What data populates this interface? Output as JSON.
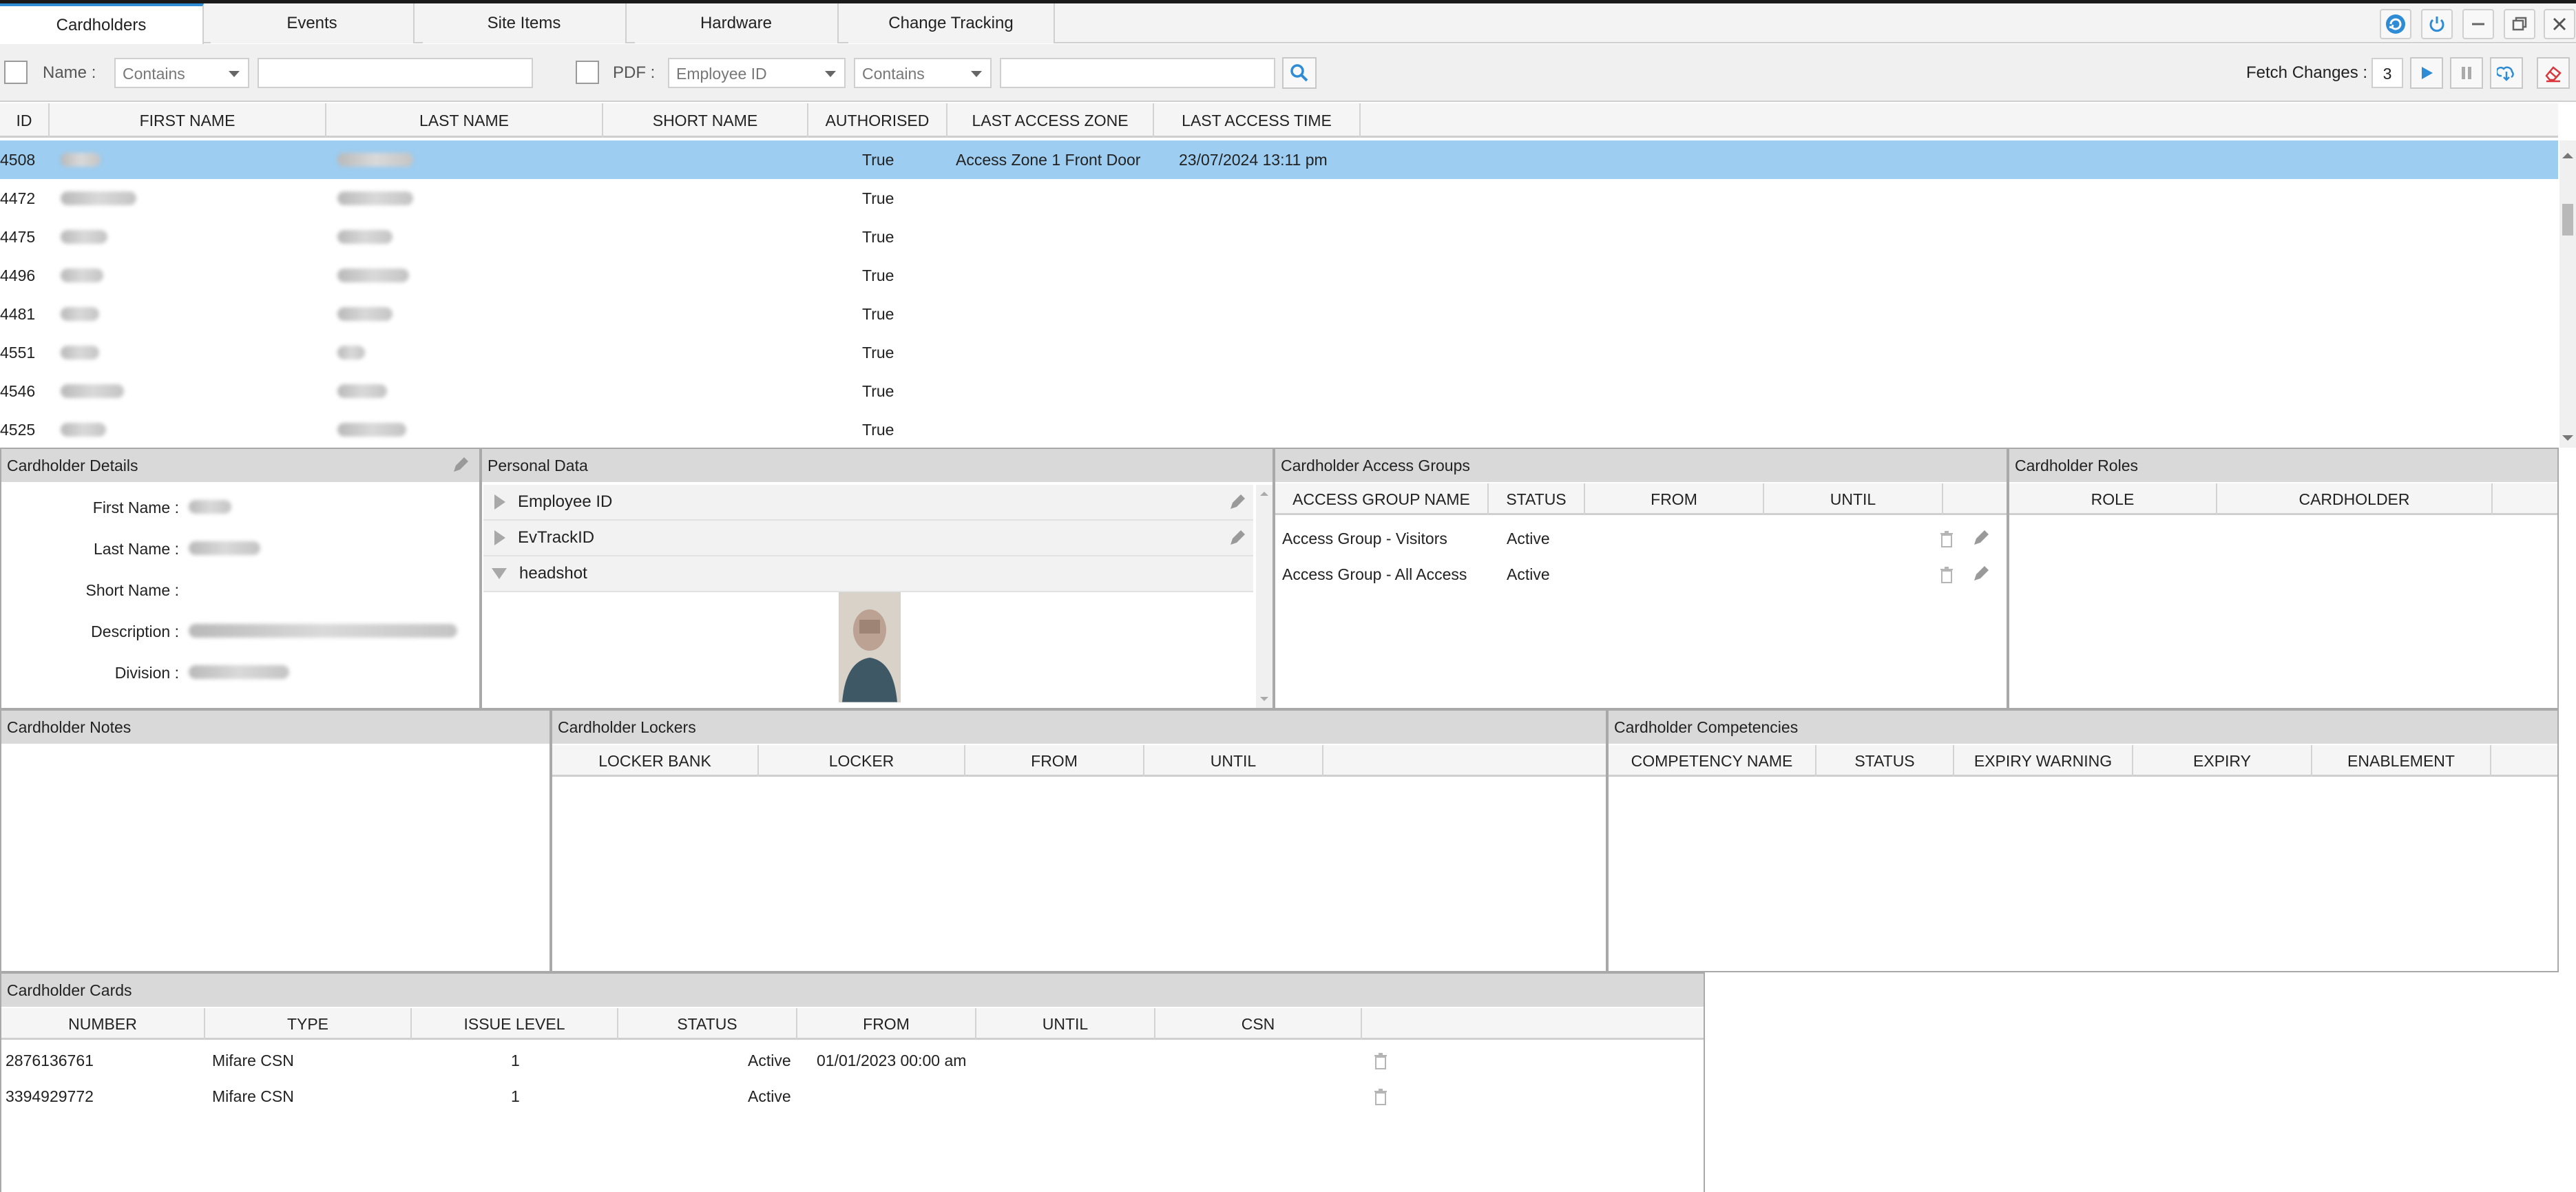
{
  "tabs": [
    "Cardholders",
    "Events",
    "Site Items",
    "Hardware",
    "Change Tracking"
  ],
  "filter": {
    "name_label": "Name :",
    "name_mode": "Contains",
    "name_value": "",
    "pdf_label": "PDF :",
    "pdf_field": "Employee ID",
    "pdf_mode": "Contains",
    "pdf_value": "",
    "fetch_label": "Fetch Changes :",
    "fetch_value": "3"
  },
  "grid": {
    "columns": [
      "ID",
      "FIRST NAME",
      "LAST NAME",
      "SHORT NAME",
      "AUTHORISED",
      "LAST ACCESS ZONE",
      "LAST ACCESS TIME"
    ],
    "rows": [
      {
        "id": "4508",
        "authorised": "True",
        "zone": "Access Zone 1 Front Door",
        "time": "23/07/2024 13:11 pm"
      },
      {
        "id": "4472",
        "authorised": "True",
        "zone": "",
        "time": ""
      },
      {
        "id": "4475",
        "authorised": "True",
        "zone": "",
        "time": ""
      },
      {
        "id": "4496",
        "authorised": "True",
        "zone": "",
        "time": ""
      },
      {
        "id": "4481",
        "authorised": "True",
        "zone": "",
        "time": ""
      },
      {
        "id": "4551",
        "authorised": "True",
        "zone": "",
        "time": ""
      },
      {
        "id": "4546",
        "authorised": "True",
        "zone": "",
        "time": ""
      },
      {
        "id": "4525",
        "authorised": "True",
        "zone": "",
        "time": ""
      }
    ]
  },
  "details": {
    "title": "Cardholder Details",
    "fields": [
      "First Name :",
      "Last Name :",
      "Short Name :",
      "Description :",
      "Division :"
    ]
  },
  "personal": {
    "title": "Personal Data",
    "items": [
      "Employee ID",
      "EvTrackID",
      "headshot"
    ]
  },
  "access_groups": {
    "title": "Cardholder Access Groups",
    "columns": [
      "ACCESS GROUP NAME",
      "STATUS",
      "FROM",
      "UNTIL"
    ],
    "rows": [
      {
        "name": "Access Group - Visitors",
        "status": "Active"
      },
      {
        "name": "Access Group - All Access",
        "status": "Active"
      }
    ]
  },
  "roles": {
    "title": "Cardholder Roles",
    "columns": [
      "ROLE",
      "CARDHOLDER"
    ]
  },
  "notes": {
    "title": "Cardholder Notes"
  },
  "lockers": {
    "title": "Cardholder Lockers",
    "columns": [
      "LOCKER BANK",
      "LOCKER",
      "FROM",
      "UNTIL"
    ]
  },
  "competencies": {
    "title": "Cardholder Competencies",
    "columns": [
      "COMPETENCY NAME",
      "STATUS",
      "EXPIRY WARNING",
      "EXPIRY",
      "ENABLEMENT"
    ]
  },
  "cards": {
    "title": "Cardholder Cards",
    "columns": [
      "NUMBER",
      "TYPE",
      "ISSUE LEVEL",
      "STATUS",
      "FROM",
      "UNTIL",
      "CSN"
    ],
    "rows": [
      {
        "number": "2876136761",
        "type": "Mifare CSN",
        "level": "1",
        "status": "Active",
        "from": "01/01/2023 00:00 am"
      },
      {
        "number": "3394929772",
        "type": "Mifare CSN",
        "level": "1",
        "status": "Active",
        "from": ""
      }
    ]
  },
  "colors": {
    "selected_row": "#9dcdf0",
    "accent": "#2e8bd6",
    "danger": "#d9363e"
  }
}
